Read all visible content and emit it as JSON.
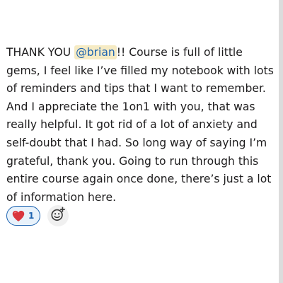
{
  "message": {
    "text_before_mention": "THANK YOU ",
    "mention": "@brian",
    "text_after_mention": "!! Course is full of little gems, I feel like I’ve filled my notebook with lots of reminders and tips that I want to remember. And I appreciate the 1on1 with you, that was really helpful. It got rid of a lot of anxiety and self-doubt that I had. So long way of saying I’m grateful, thank you. Going to run through this entire course again once done, there’s just a lot of information here."
  },
  "reactions": [
    {
      "icon": "heart-icon",
      "count": "1",
      "color": "#d9363e"
    }
  ],
  "add_reaction_icon": "add-emoji-icon",
  "colors": {
    "mention_bg": "#f6ebc4",
    "mention_text": "#1d63b0",
    "reaction_border": "#1d63b0",
    "reaction_bg": "#e8f2fb"
  }
}
